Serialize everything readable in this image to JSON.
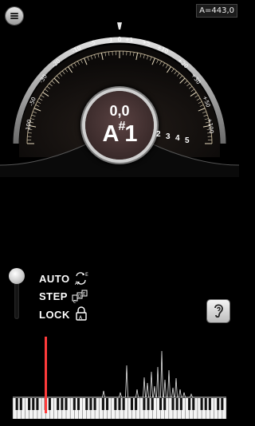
{
  "header": {
    "menu_icon": "hamburger-menu-icon",
    "reference_pitch": "A=443,0"
  },
  "gauge": {
    "left_labels": [
      "-1",
      "-5",
      "-10",
      "-20",
      "-30",
      "-50",
      "-100"
    ],
    "right_labels": [
      "+1",
      "+5",
      "+10",
      "+20",
      "+30",
      "+50",
      "+100"
    ],
    "center_label": "0",
    "needle_cents": 0
  },
  "readout": {
    "cents": "0,0",
    "note_letter": "A",
    "accidental": "#",
    "octave": "1"
  },
  "octave_indicator": [
    "2",
    "3",
    "4",
    "5"
  ],
  "modes": {
    "auto": "AUTO",
    "step": "STEP",
    "lock": "LOCK",
    "selected": "AUTO",
    "auto_icon": "auto-cycle-icon",
    "step_icon": "step-notes-icon",
    "lock_icon": "lock-icon"
  },
  "ear_button": {
    "icon": "ear-icon"
  },
  "spectrum": {
    "marker_color": "#ff3b3b",
    "keyboard_keys": 52
  }
}
